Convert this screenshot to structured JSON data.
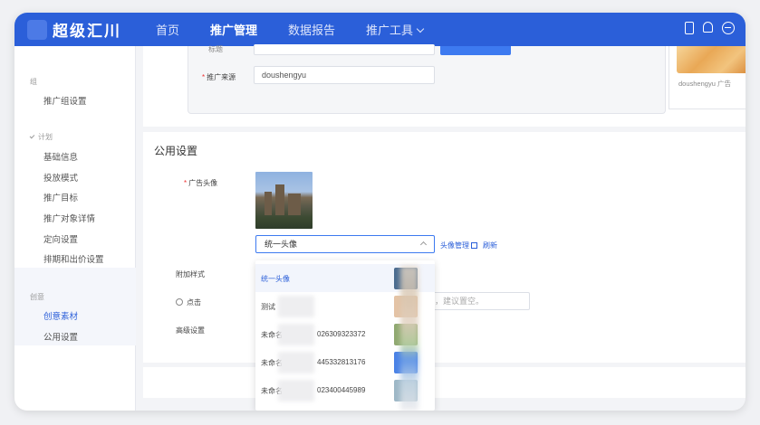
{
  "app": {
    "brand": "超级汇川"
  },
  "nav": {
    "items": [
      {
        "label": "首页",
        "active": false
      },
      {
        "label": "推广管理",
        "active": true
      },
      {
        "label": "数据报告",
        "active": false
      },
      {
        "label": "推广工具",
        "active": false
      }
    ]
  },
  "sidebar": {
    "group_top": "组",
    "item_group_setting": "推广组设置",
    "group_plan": "计划",
    "plan_items": [
      "基础信息",
      "投放模式",
      "推广目标",
      "推广对象详情",
      "定向设置",
      "排期和出价设置"
    ],
    "group_creative": "创意",
    "creative_items": [
      "创意素材",
      "公用设置"
    ]
  },
  "upper_form": {
    "label_truncated": "标题",
    "promo_source_label": "推广来源",
    "promo_source_value": "doushengyu",
    "preview_caption": "doushengyu  广告"
  },
  "public_settings": {
    "title": "公用设置",
    "avatar_label": "广告头像",
    "avatar_select_value": "统一头像",
    "avatar_manage_link": "头像管理",
    "refresh_link": "刷新",
    "extra_style_label": "附加样式",
    "click_label": "点击",
    "click_hint": "能，建议置空。",
    "advanced_label": "高级设置"
  },
  "avatar_dropdown": {
    "items": [
      {
        "label": "统一头像",
        "num": "",
        "selected": true,
        "thumb": "#4a6b8f"
      },
      {
        "label": "测试",
        "num": "",
        "selected": false,
        "thumb": "#e4c3a5"
      },
      {
        "label": "未命名",
        "num": "026309323372",
        "selected": false,
        "thumb": "#8fa870"
      },
      {
        "label": "未命名",
        "num": "445332813176",
        "selected": false,
        "thumb": "#4a82e6"
      },
      {
        "label": "未命名",
        "num": "023400445989",
        "selected": false,
        "thumb": "#9db7c6"
      }
    ]
  },
  "colors": {
    "primary": "#2b5fd9",
    "accent": "#3d7af0",
    "required": "#e33333"
  }
}
